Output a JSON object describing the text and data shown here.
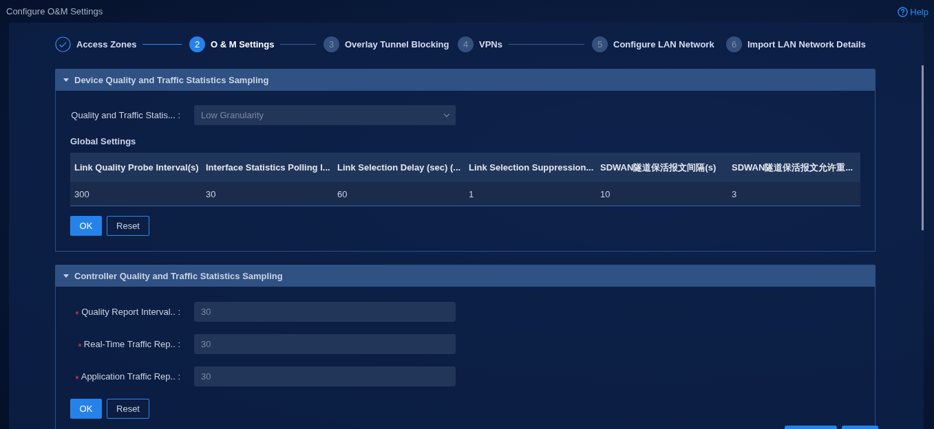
{
  "window": {
    "title": "Configure O&M Settings",
    "help": "Help"
  },
  "steps": [
    {
      "label": "Access Zones",
      "done": true,
      "selected": false
    },
    {
      "number": "2",
      "label": "O & M Settings",
      "done": false,
      "selected": true
    },
    {
      "number": "3",
      "label": "Overlay Tunnel Blocking",
      "done": false,
      "selected": false
    },
    {
      "number": "4",
      "label": "VPNs",
      "done": false,
      "selected": false
    },
    {
      "number": "5",
      "label": "Configure LAN Network",
      "done": false,
      "selected": false
    },
    {
      "number": "6",
      "label": "Import LAN Network Details",
      "done": false,
      "selected": false
    }
  ],
  "sections": [
    {
      "title": "Device Quality and Traffic Statistics Sampling",
      "expanded": true,
      "fields": [
        {
          "kind": "select",
          "label": "Quality and Traffic Statis... :",
          "required": false,
          "value": "Low Granularity"
        }
      ],
      "subheading": "Global Settings",
      "table": {
        "columns": [
          "Link Quality Probe Interval(s)",
          "Interface Statistics Polling I...",
          "Link Selection Delay (sec) (...",
          "Link Selection Suppression...",
          "SDWAN隧道保活报文间隔(s)",
          "SDWAN隧道保活报文允许重..."
        ],
        "rows": [
          [
            "300",
            "30",
            "60",
            "1",
            "10",
            "3"
          ]
        ]
      },
      "buttons": [
        {
          "label": "OK",
          "kind": "primary"
        },
        {
          "label": "Reset",
          "kind": "secondary"
        }
      ]
    },
    {
      "title": "Controller Quality and Traffic Statistics Sampling",
      "expanded": true,
      "fields": [
        {
          "kind": "input",
          "label": "Quality Report Interval.. :",
          "required": true,
          "value": "30"
        },
        {
          "kind": "input",
          "label": "Real-Time Traffic Rep.. :",
          "required": true,
          "value": "30"
        },
        {
          "kind": "input",
          "label": "Application Traffic Rep.. :",
          "required": true,
          "value": "30"
        }
      ],
      "buttons": [
        {
          "label": "OK",
          "kind": "primary"
        },
        {
          "label": "Reset",
          "kind": "secondary"
        }
      ]
    }
  ]
}
